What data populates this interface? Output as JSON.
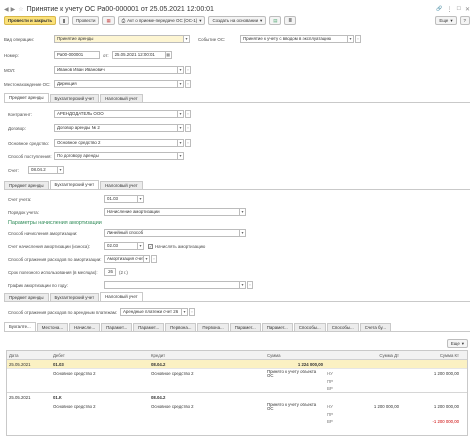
{
  "window": {
    "title": "Принятие к учету ОС Ра00-000001 от 25.05.2021 12:00:01",
    "more_label": "Еще",
    "help_label": "?"
  },
  "toolbar": {
    "post_close": "Провести и закрыть",
    "save": "Провести",
    "act_print": "Акт о приеме-передаче ОС (ОС-1)",
    "create_based": "Создать на основании"
  },
  "header": {
    "operation_label": "Вид операции:",
    "operation_value": "Принятие аренды",
    "event_label": "Событие ОС:",
    "event_value": "Принятие к учету с вводом в эксплуатацию",
    "number_label": "Номер:",
    "number_value": "Ра00-000001",
    "date_prefix": "от:",
    "date_value": "25.05.2021 12:00:01",
    "mol_label": "МОЛ:",
    "mol_value": "Иванов Иван Иванович",
    "location_label": "Местонахождение ОС:",
    "location_value": "Дирекция"
  },
  "tabs_top": [
    "Предмет аренды",
    "Бухгалтерский учет",
    "Налоговый учет"
  ],
  "lease": {
    "counterparty_label": "Контрагент:",
    "counterparty_value": "АРЕНДОДАТЕЛЬ ООО",
    "contract_label": "Договор:",
    "contract_value": "Договор аренды № 2",
    "asset_label": "Основное средство:",
    "asset_value": "Основное средство 2",
    "receipt_label": "Способ поступления:",
    "receipt_value": "По договору аренды",
    "account_label": "Счет:",
    "account_value": "08.04.2"
  },
  "tabs_mid": [
    "Предмет аренды",
    "Бухгалтерский учет",
    "Налоговый учет"
  ],
  "accounting": {
    "account_label": "Счет учета:",
    "account_value": "01.03",
    "procedure_label": "Порядок учета:",
    "procedure_value": "Начисление амортизации",
    "params_title": "Параметры начисления амортизации",
    "method_label": "Способ начисления амортизации:",
    "method_value": "Линейный способ",
    "amort_account_label": "Счет начисления амортизации (износа):",
    "amort_account_value": "02.03",
    "accrue_label": "Начислять амортизацию",
    "expense_label": "Способ отражения расходов по амортизации:",
    "expense_value": "Амортизация счет 26",
    "life_label": "Срок полезного использования (в месяцах):",
    "life_value": "26",
    "life_suffix": "(2 г.)",
    "schedule_label": "График амортизации по году:",
    "schedule_value": ""
  },
  "tabs_low": [
    "Предмет аренды",
    "Бухгалтерский учет",
    "Налоговый учет"
  ],
  "lease_expense": {
    "label": "Способ отражения расходов по арендным платежам:",
    "value": "Арендные платежи счет 26"
  },
  "tabs_bottom": [
    "Бухгалте...",
    "Местона...",
    "Начисле...",
    "Парамет...",
    "Парамет...",
    "Первона...",
    "Первона...",
    "Парамет...",
    "Парамет...",
    "Способы...",
    "Способы...",
    "Счета бу..."
  ],
  "grid": {
    "more_label": "Еще",
    "columns": [
      "Дата",
      "Дебет",
      "",
      "Кредит",
      "",
      "Сумма",
      "",
      "Сумма Дт",
      "Сумма Кт"
    ],
    "rows": [
      {
        "date": "25.05.2021",
        "debit": "01.03",
        "debit_sub": "Основное средство 2",
        "credit": "08.04.2",
        "credit_sub": "Основное средство 2",
        "amount": "1 224 000,00",
        "content": "Принято к учету объекта ОС",
        "tags": [
          "НУ",
          "ПР",
          "ВР"
        ],
        "dt": [
          "",
          "",
          ""
        ],
        "kt": [
          "1 200 000,00",
          "",
          ""
        ]
      },
      {
        "date": "25.05.2021",
        "debit": "01.К",
        "debit_sub": "Основное средство 2",
        "credit": "08.04.2",
        "credit_sub": "Основное средство 2",
        "amount": "",
        "content": "Принято к учету объекта ОС",
        "tags": [
          "НУ",
          "ПР",
          "ВР"
        ],
        "dt": [
          "1 200 000,00",
          "",
          ""
        ],
        "kt": [
          "1 200 000,00",
          "",
          "-1 200 000,00"
        ]
      }
    ]
  },
  "colors": {
    "accent": "#fbe17a",
    "selected_row": "#fbf1c3",
    "section": "#2e8b57"
  }
}
